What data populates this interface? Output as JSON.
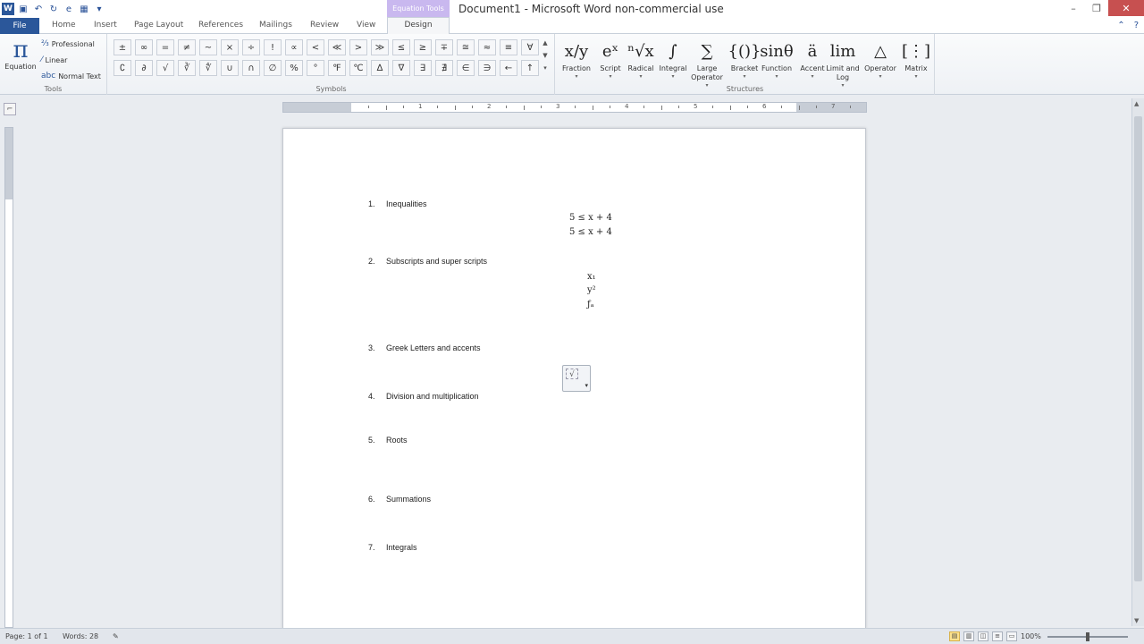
{
  "titlebar": {
    "title": "Document1 - Microsoft Word non-commercial use",
    "context_label": "Equation Tools",
    "qat_icons": [
      "word-logo-icon",
      "save-icon",
      "undo-icon",
      "redo-icon",
      "equation-icon",
      "table-icon",
      "customize-icon"
    ]
  },
  "tabs": {
    "file": "File",
    "home": "Home",
    "insert": "Insert",
    "page_layout": "Page Layout",
    "references": "References",
    "mailings": "Mailings",
    "review": "Review",
    "view": "View",
    "design": "Design"
  },
  "ribbon": {
    "tools": {
      "group_label": "Tools",
      "equation": "Equation",
      "professional": "Professional",
      "linear": "Linear",
      "normal_text": "Normal Text"
    },
    "symbols": {
      "group_label": "Symbols",
      "row1": [
        "±",
        "∞",
        "=",
        "≠",
        "~",
        "×",
        "÷",
        "!",
        "∝",
        "<",
        "≪",
        ">",
        "≫",
        "≤",
        "≥",
        "∓",
        "≅",
        "≈",
        "≡",
        "∀"
      ],
      "row2": [
        "∁",
        "∂",
        "√",
        "∛",
        "∜",
        "∪",
        "∩",
        "∅",
        "%",
        "°",
        "℉",
        "℃",
        "∆",
        "∇",
        "∃",
        "∄",
        "∈",
        "∋",
        "←",
        "↑"
      ]
    },
    "structures": {
      "group_label": "Structures",
      "items": [
        {
          "label": "Fraction",
          "glyph": "x/y"
        },
        {
          "label": "Script",
          "glyph": "eˣ"
        },
        {
          "label": "Radical",
          "glyph": "ⁿ√x"
        },
        {
          "label": "Integral",
          "glyph": "∫"
        },
        {
          "label": "Large Operator",
          "glyph": "∑"
        },
        {
          "label": "Bracket",
          "glyph": "{()}"
        },
        {
          "label": "Function",
          "glyph": "sinθ"
        },
        {
          "label": "Accent",
          "glyph": "ä"
        },
        {
          "label": "Limit and Log",
          "glyph": "lim"
        },
        {
          "label": "Operator",
          "glyph": "△"
        },
        {
          "label": "Matrix",
          "glyph": "[⋮]"
        }
      ]
    }
  },
  "document": {
    "items": [
      {
        "num": "1.",
        "text": "Inequalities"
      },
      {
        "num": "2.",
        "text": "Subscripts and super scripts"
      },
      {
        "num": "3.",
        "text": "Greek Letters and accents"
      },
      {
        "num": "4.",
        "text": "Division and multiplication"
      },
      {
        "num": "5.",
        "text": "Roots"
      },
      {
        "num": "6.",
        "text": "Summations"
      },
      {
        "num": "7.",
        "text": "Integrals"
      }
    ],
    "equations": {
      "ineq1": "5 ≤ x + 4",
      "ineq2": "5 ≤ x + 4",
      "sub1": "x₁",
      "sub2": "y²",
      "sub3": "ƒₐ"
    }
  },
  "ruler": {
    "numbers": [
      "1",
      "2",
      "3",
      "4",
      "5",
      "6",
      "7"
    ]
  },
  "statusbar": {
    "page": "Page: 1 of 1",
    "words": "Words: 28",
    "zoom": "100%"
  }
}
